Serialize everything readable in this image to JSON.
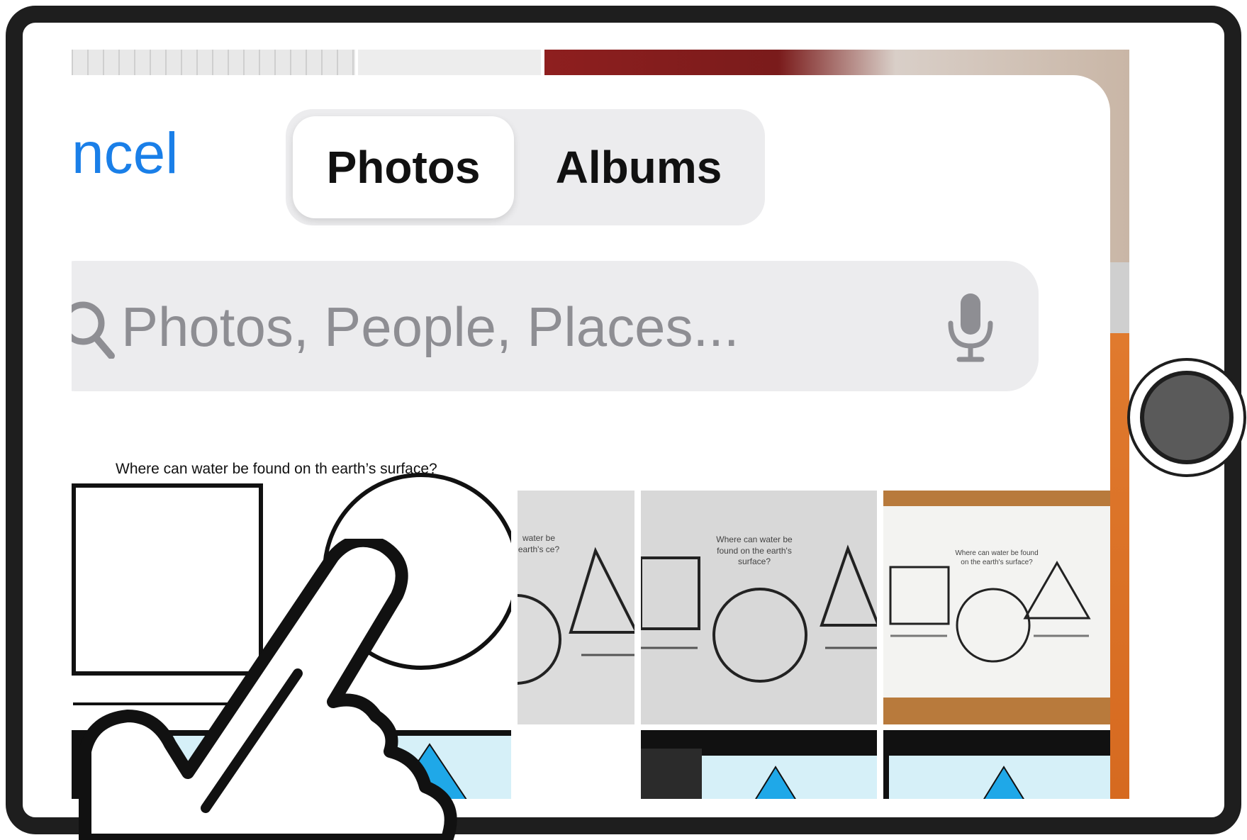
{
  "nav": {
    "cancel_label": "ncel"
  },
  "segmented": {
    "photos_label": "Photos",
    "albums_label": "Albums",
    "selected": "Photos"
  },
  "search": {
    "placeholder": "Photos, People, Places..."
  },
  "grid": {
    "first_tile_question": "Where can water be found on th earth’s surface?",
    "photo_label_2": "Where can water be found on the earth's surface?",
    "photo_label_3": "Where can water be found on the earth's surface?",
    "photo_label_1": "water be earth's ce?"
  },
  "colors": {
    "accent": "#1a7fe8",
    "bezel": "#1e1e1e",
    "field_bg": "#ececee",
    "triangle_fill": "#1fa8e8"
  },
  "icons": [
    "search-icon",
    "microphone-icon",
    "home-button",
    "hand-pointer-icon"
  ]
}
